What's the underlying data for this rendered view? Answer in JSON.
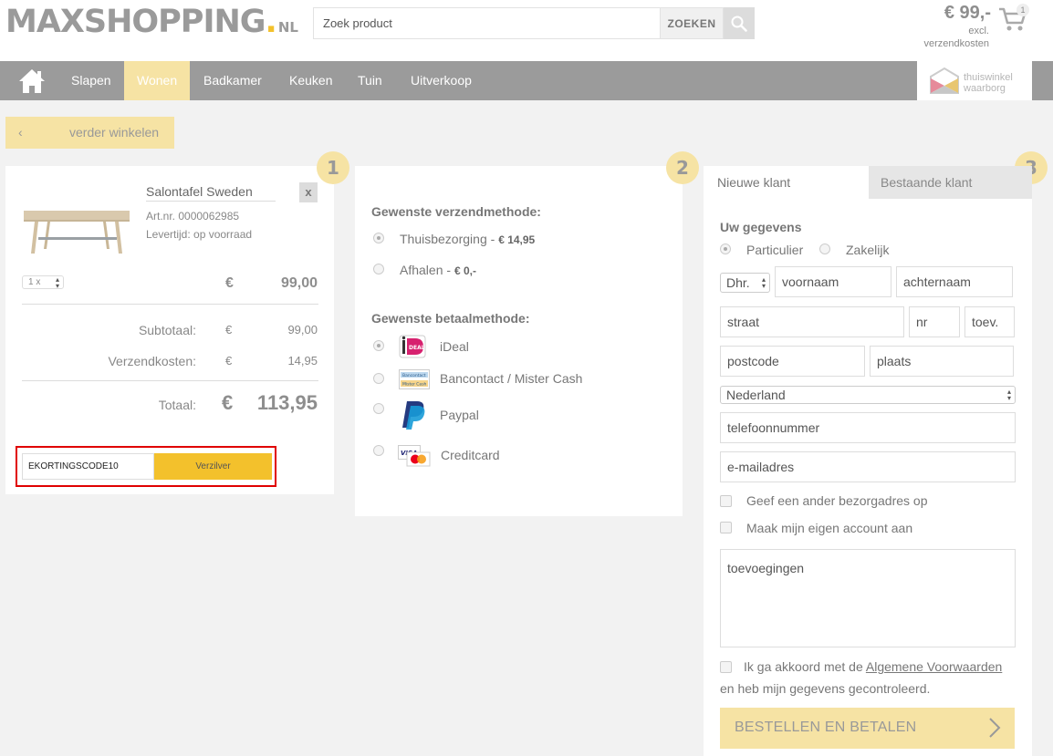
{
  "header": {
    "logo_main": "MAXSHOPPING",
    "logo_dot": ".",
    "logo_suffix": "NL",
    "search_placeholder": "Zoek product",
    "search_button": "ZOEKEN",
    "cart_price": "€ 99,-",
    "cart_note_line1": "excl.",
    "cart_note_line2": "verzendkosten",
    "cart_count": "1"
  },
  "nav": {
    "items": [
      "Slapen",
      "Wonen",
      "Badkamer",
      "Keuken",
      "Tuin",
      "Uitverkoop"
    ],
    "active": "Wonen",
    "badge_line1": "thuiswinkel",
    "badge_line2": "waarborg"
  },
  "continue_label": "verder winkelen",
  "steps": [
    "1",
    "2",
    "3"
  ],
  "cart": {
    "product_name": "Salontafel Sweden",
    "remove_label": "x",
    "article": "Art.nr. 0000062985",
    "delivery": "Levertijd: op voorraad",
    "quantity": "1 x",
    "currency": "€",
    "line_price": "99,00",
    "subtotal_label": "Subtotaal:",
    "subtotal": "99,00",
    "shipping_label": "Verzendkosten:",
    "shipping": "14,95",
    "total_label": "Totaal:",
    "total": "113,95",
    "coupon_value": "EKORTINGSCODE10",
    "coupon_button": "Verzilver"
  },
  "shipping_section": {
    "title": "Gewenste verzendmethode:",
    "options": [
      {
        "label": "Thuisbezorging",
        "price": "€ 14,95",
        "selected": true
      },
      {
        "label": "Afhalen",
        "price": "€ 0,-",
        "selected": false
      }
    ]
  },
  "payment_section": {
    "title": "Gewenste betaalmethode:",
    "options": [
      {
        "label": "iDeal",
        "icon": "ideal-logo-icon",
        "selected": true
      },
      {
        "label": "Bancontact / Mister Cash",
        "icon": "bancontact-logo-icon",
        "selected": false
      },
      {
        "label": "Paypal",
        "icon": "paypal-logo-icon",
        "selected": false
      },
      {
        "label": "Creditcard",
        "icon": "creditcard-logo-icon",
        "selected": false
      }
    ]
  },
  "customer": {
    "tab_new": "Nieuwe klant",
    "tab_existing": "Bestaande klant",
    "section_title": "Uw gegevens",
    "type_private": "Particulier",
    "type_business": "Zakelijk",
    "salutation": "Dhr.",
    "placeholders": {
      "firstname": "voornaam",
      "lastname": "achternaam",
      "street": "straat",
      "number": "nr",
      "addition": "toev.",
      "postcode": "postcode",
      "city": "plaats",
      "phone": "telefoonnummer",
      "email": "e-mailadres",
      "notes": "toevoegingen"
    },
    "country": "Nederland",
    "other_address": "Geef een ander bezorgadres op",
    "create_account": "Maak mijn eigen account aan",
    "terms_prefix": "Ik ga akkoord met de",
    "terms_link": "Algemene Voorwaarden",
    "terms_suffix": "en heb mijn gegevens gecontroleerd.",
    "order_button": "BESTELLEN EN BETALEN"
  },
  "colors": {
    "accent": "#f3c12c",
    "accent_light": "#f6e3a4",
    "nav_bg": "#9b9b9b",
    "highlight": "#e00000"
  }
}
